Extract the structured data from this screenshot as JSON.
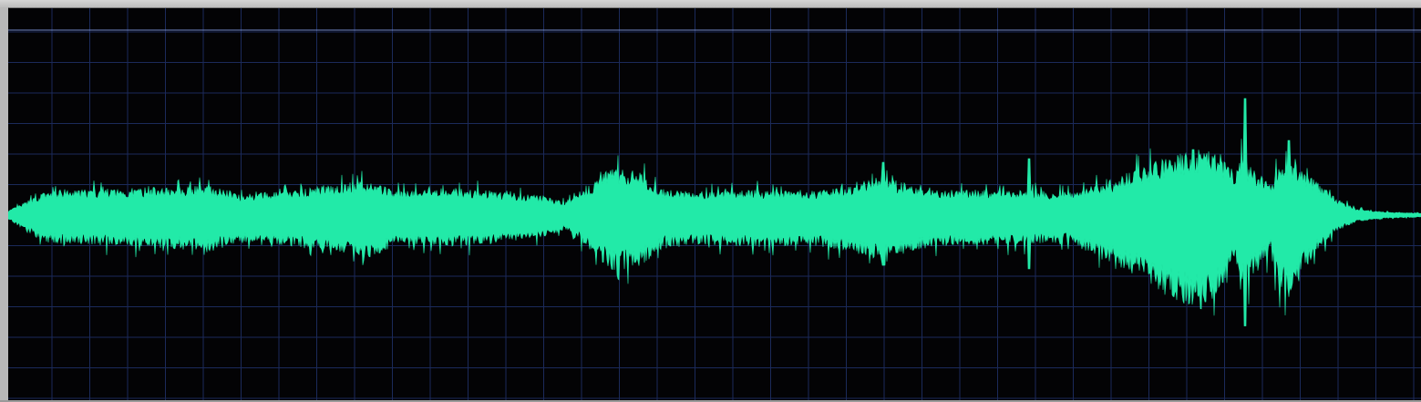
{
  "editor": {
    "view": "waveform",
    "colors": {
      "background": "#030305",
      "grid": "#1b2a5a",
      "waveform": "#22eaa8",
      "channel_top_line": "#6f86c4",
      "frame": "#c8c8c8"
    },
    "grid": true,
    "channels": 1
  }
}
